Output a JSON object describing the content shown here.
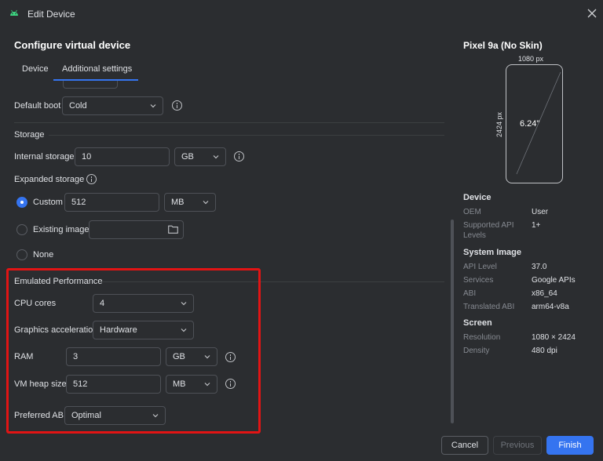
{
  "window": {
    "title": "Edit Device"
  },
  "heading": "Configure virtual device",
  "tabs": [
    {
      "label": "Device"
    },
    {
      "label": "Additional settings"
    }
  ],
  "fields": {
    "default_boot": {
      "label": "Default boot",
      "value": "Cold"
    },
    "storage_section": "Storage",
    "internal_storage": {
      "label": "Internal storage",
      "value": "10",
      "unit": "GB"
    },
    "expanded_storage": {
      "label": "Expanded storage"
    },
    "custom": {
      "label": "Custom",
      "value": "512",
      "unit": "MB",
      "selected": true
    },
    "existing_image": {
      "label": "Existing image",
      "value": ""
    },
    "none": {
      "label": "None"
    }
  },
  "performance": {
    "section": "Emulated Performance",
    "cpu_cores": {
      "label": "CPU cores",
      "value": "4"
    },
    "graphics": {
      "label": "Graphics acceleration",
      "value": "Hardware"
    },
    "ram": {
      "label": "RAM",
      "value": "3",
      "unit": "GB"
    },
    "vm_heap": {
      "label": "VM heap size",
      "value": "512",
      "unit": "MB"
    },
    "preferred_abi": {
      "label": "Preferred ABI",
      "value": "Optimal"
    }
  },
  "preview": {
    "device_name": "Pixel 9a (No Skin)",
    "width_px": "1080 px",
    "height_px": "2424 px",
    "screen_size": "6.24”"
  },
  "device_info": {
    "title": "Device",
    "oem_key": "OEM",
    "oem_val": "User",
    "api_key": "Supported API",
    "api_key2": "Levels",
    "api_val": "1+"
  },
  "system_image": {
    "title": "System Image",
    "api_level_key": "API Level",
    "api_level_val": "37.0",
    "services_key": "Services",
    "services_val": "Google APIs",
    "abi_key": "ABI",
    "abi_val": "x86_64",
    "translated_key": "Translated ABI",
    "translated_val": "arm64-v8a"
  },
  "screen": {
    "title": "Screen",
    "resolution_key": "Resolution",
    "resolution_val": "1080 × 2424",
    "density_key": "Density",
    "density_val": "480 dpi"
  },
  "buttons": {
    "cancel": "Cancel",
    "previous": "Previous",
    "finish": "Finish"
  },
  "colors": {
    "accent": "#3574f0",
    "highlight": "#e21414",
    "background": "#2b2d30"
  }
}
